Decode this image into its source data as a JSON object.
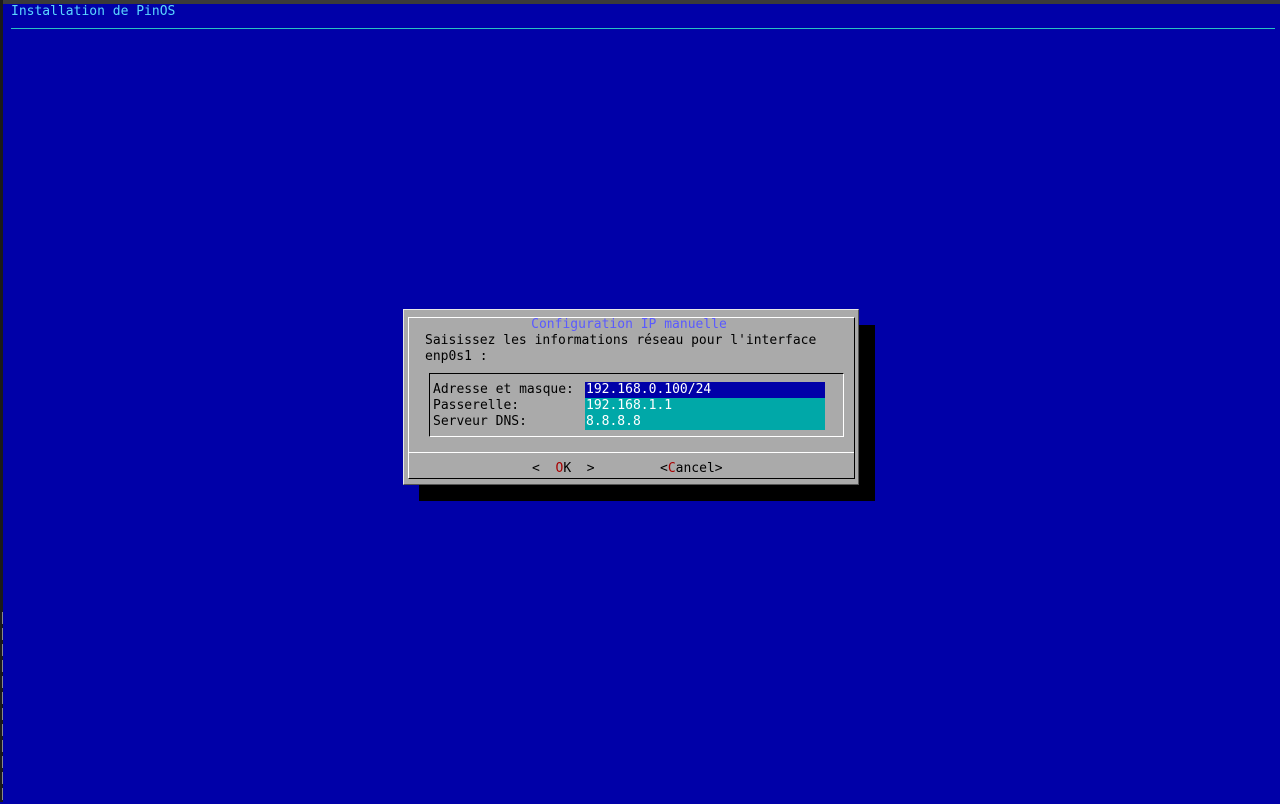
{
  "window": {
    "title": "Installation de PinOS"
  },
  "dialog": {
    "title": "Configuration IP manuelle",
    "prompt": "Saisissez les informations réseau pour l'interface\nenp0s1 :",
    "fields": [
      {
        "label": "Adresse et masque:",
        "value": "192.168.0.100/24",
        "focused": true
      },
      {
        "label": "Passerelle:",
        "value": "192.168.1.1",
        "focused": false
      },
      {
        "label": "Serveur DNS:",
        "value": "8.8.8.8",
        "focused": false
      }
    ],
    "buttons": {
      "ok": {
        "left": "<",
        "hotkey": "O",
        "rest": "K",
        "right": ">"
      },
      "cancel": {
        "left": "<",
        "hotkey": "C",
        "rest": "ancel",
        "right": ">"
      }
    }
  },
  "colors": {
    "background": "#0000a8",
    "dialog": "#aaaaaa",
    "title_text": "#5ad6ff",
    "input_bg": "#00a8a8",
    "input_focused_bg": "#0000a8",
    "hotkey": "#a80000"
  }
}
